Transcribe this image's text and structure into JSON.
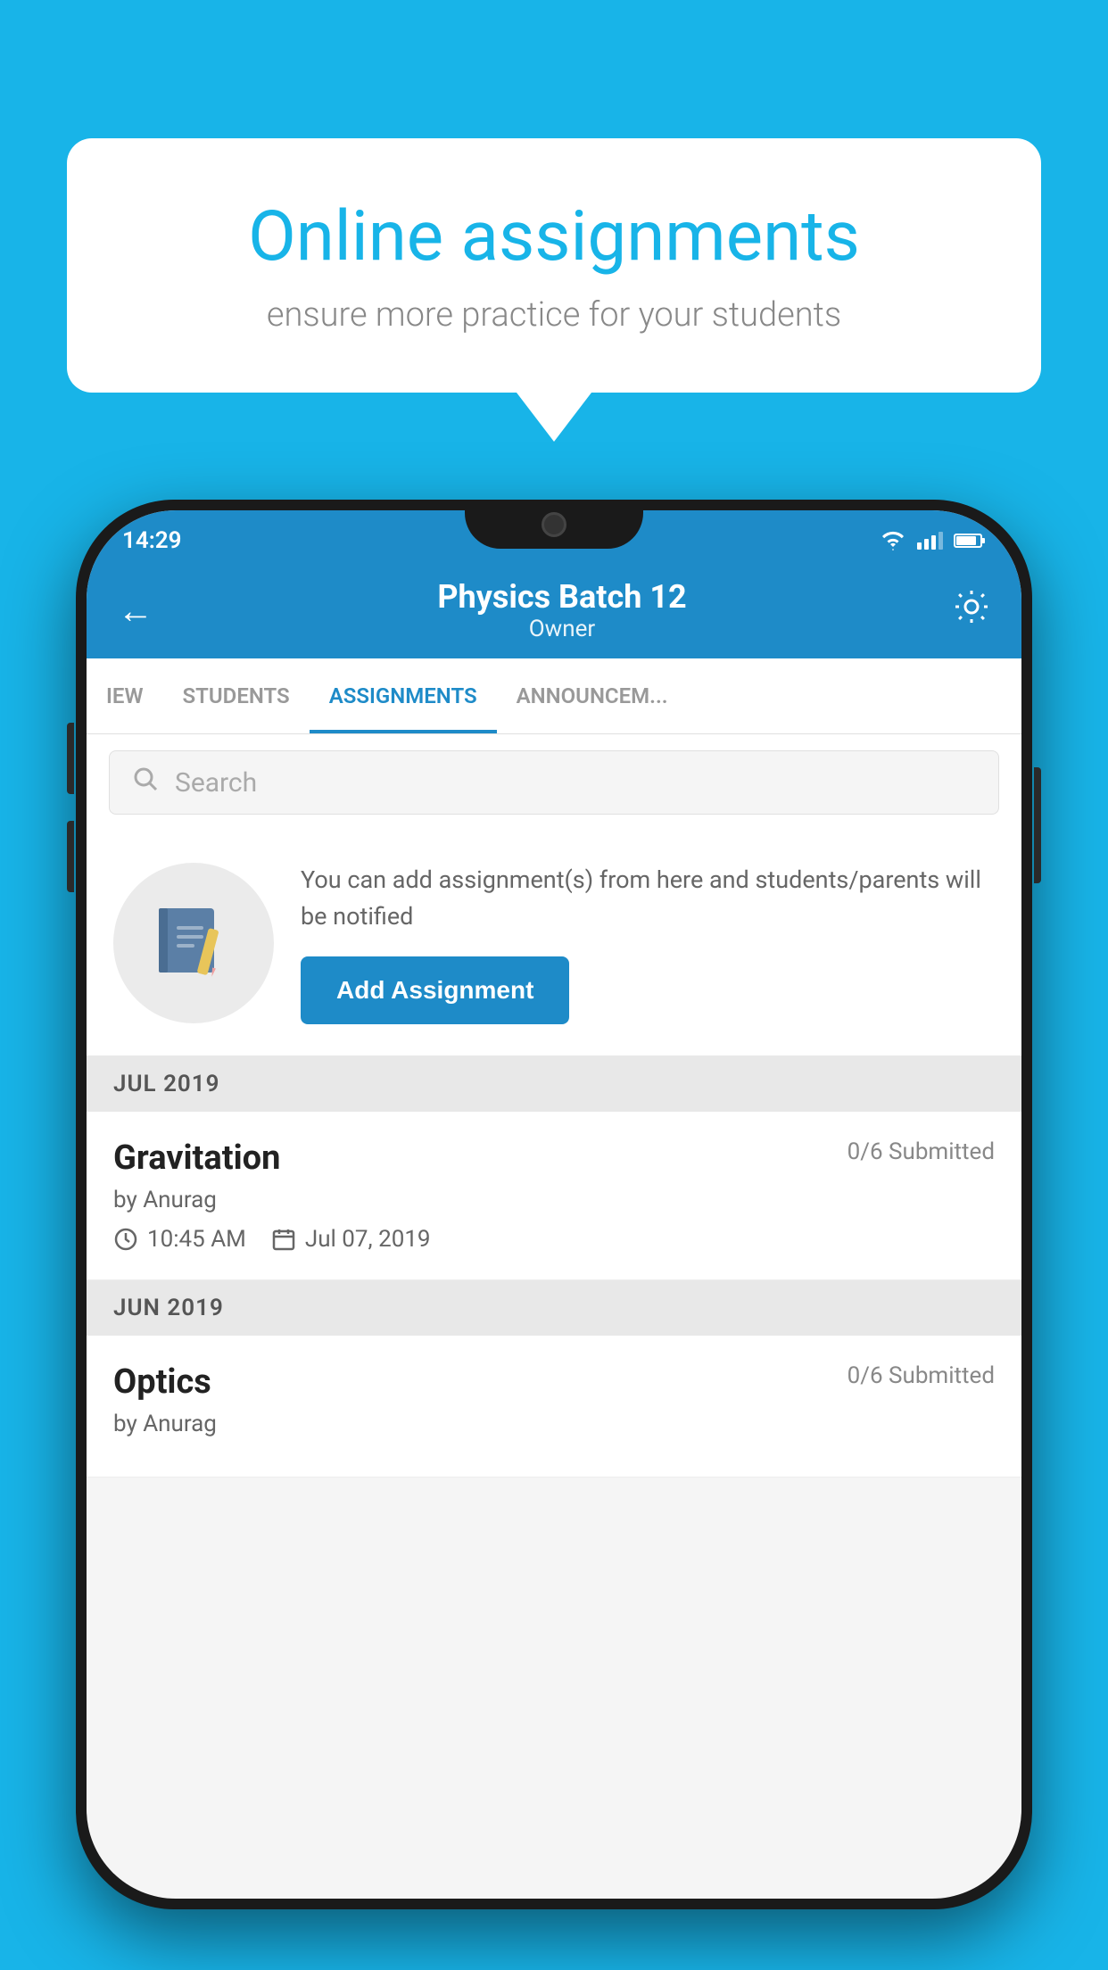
{
  "background": {
    "color": "#18b4e8"
  },
  "speech_bubble": {
    "title": "Online assignments",
    "subtitle": "ensure more practice for your students"
  },
  "phone": {
    "status_bar": {
      "time": "14:29"
    },
    "header": {
      "title": "Physics Batch 12",
      "subtitle": "Owner",
      "back_label": "←",
      "settings_label": "⚙"
    },
    "tabs": [
      {
        "label": "IEW",
        "active": false
      },
      {
        "label": "STUDENTS",
        "active": false
      },
      {
        "label": "ASSIGNMENTS",
        "active": true
      },
      {
        "label": "ANNOUNCEM...",
        "active": false
      }
    ],
    "search": {
      "placeholder": "Search"
    },
    "promo": {
      "description": "You can add assignment(s) from here and students/parents will be notified",
      "button_label": "Add Assignment"
    },
    "sections": [
      {
        "header": "JUL 2019",
        "assignments": [
          {
            "title": "Gravitation",
            "status": "0/6 Submitted",
            "by": "by Anurag",
            "time": "10:45 AM",
            "date": "Jul 07, 2019"
          }
        ]
      },
      {
        "header": "JUN 2019",
        "assignments": [
          {
            "title": "Optics",
            "status": "0/6 Submitted",
            "by": "by Anurag",
            "time": "",
            "date": ""
          }
        ]
      }
    ]
  }
}
